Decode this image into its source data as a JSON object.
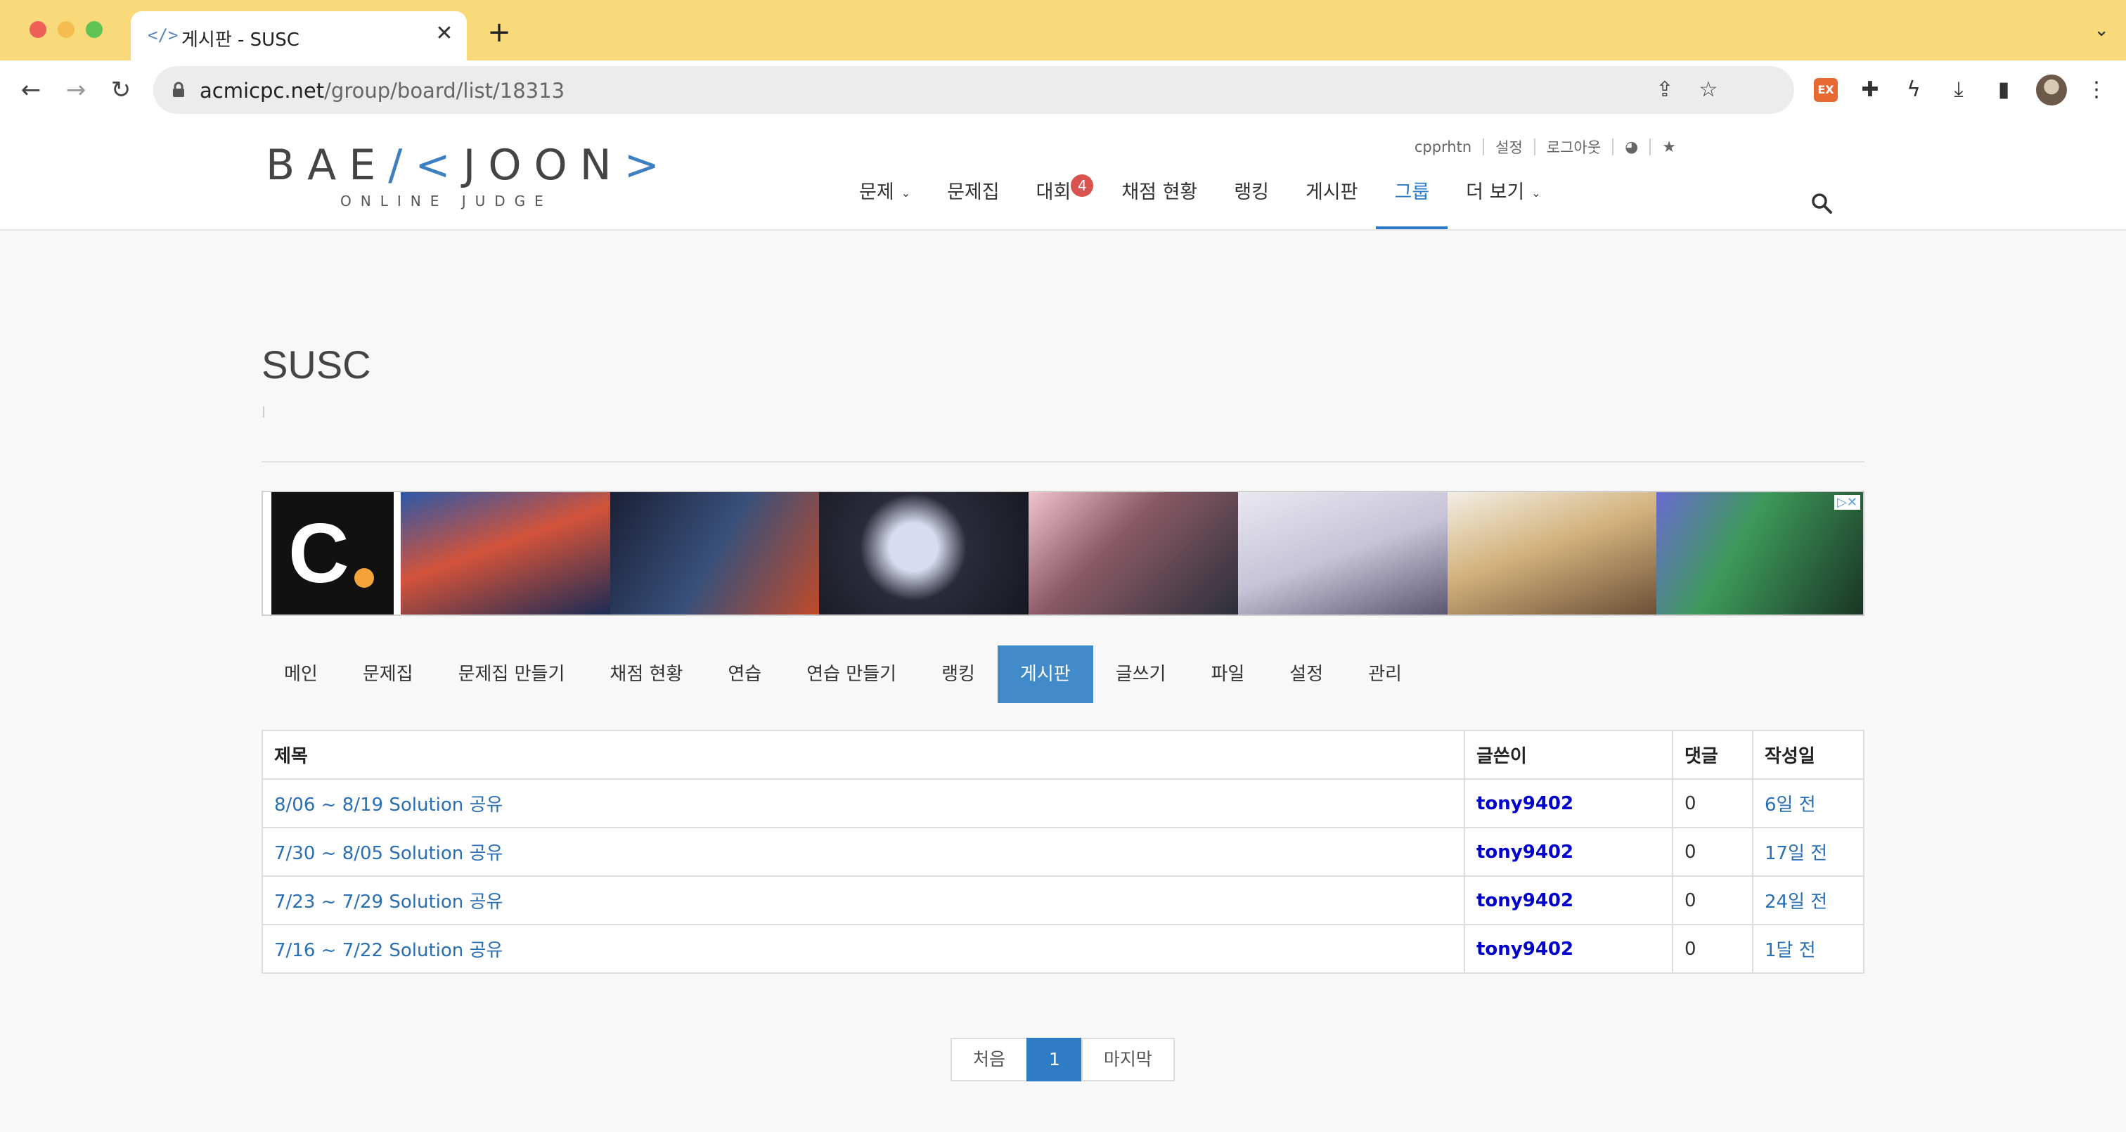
{
  "browser": {
    "tab_icon": "</>",
    "tab_title": "게시판 - SUSC",
    "tab_close": "✕",
    "new_tab": "+",
    "tab_menu": "⌄",
    "url_domain": "acmicpc.net",
    "url_path": "/group/board/list/18313",
    "ext_ex_label": "EX",
    "colors": {
      "tabbar": "#f9da7a"
    }
  },
  "site": {
    "logo": {
      "left": "BAE",
      "bracket": "/<",
      "right": "JOON",
      "close": ">",
      "sub": "ONLINE JUDGE"
    },
    "user_links": [
      "cpprhtn",
      "설정",
      "로그아웃"
    ],
    "nav": [
      {
        "label": "문제",
        "dropdown": true
      },
      {
        "label": "문제집"
      },
      {
        "label": "대회",
        "badge": "4"
      },
      {
        "label": "채점 현황"
      },
      {
        "label": "랭킹"
      },
      {
        "label": "게시판"
      },
      {
        "label": "그룹",
        "active": true
      },
      {
        "label": "더 보기",
        "dropdown": true
      }
    ],
    "accent": "#2a7ac7"
  },
  "group": {
    "title": "SUSC",
    "banner_ad_marks": "▷✕",
    "banner_logo": "C"
  },
  "subnav": [
    {
      "label": "메인"
    },
    {
      "label": "문제집"
    },
    {
      "label": "문제집 만들기"
    },
    {
      "label": "채점 현황"
    },
    {
      "label": "연습"
    },
    {
      "label": "연습 만들기"
    },
    {
      "label": "랭킹"
    },
    {
      "label": "게시판",
      "active": true
    },
    {
      "label": "글쓰기"
    },
    {
      "label": "파일"
    },
    {
      "label": "설정"
    },
    {
      "label": "관리"
    }
  ],
  "board": {
    "headers": {
      "title": "제목",
      "author": "글쓴이",
      "comments": "댓글",
      "date": "작성일"
    },
    "rows": [
      {
        "title": "8/06 ~ 8/19 Solution 공유",
        "author": "tony9402",
        "comments": "0",
        "date": "6일 전"
      },
      {
        "title": "7/30 ~ 8/05 Solution 공유",
        "author": "tony9402",
        "comments": "0",
        "date": "17일 전"
      },
      {
        "title": "7/23 ~ 7/29 Solution 공유",
        "author": "tony9402",
        "comments": "0",
        "date": "24일 전"
      },
      {
        "title": "7/16 ~ 7/22 Solution 공유",
        "author": "tony9402",
        "comments": "0",
        "date": "1달 전"
      }
    ]
  },
  "pagination": {
    "first": "처음",
    "current": "1",
    "last": "마지막"
  }
}
